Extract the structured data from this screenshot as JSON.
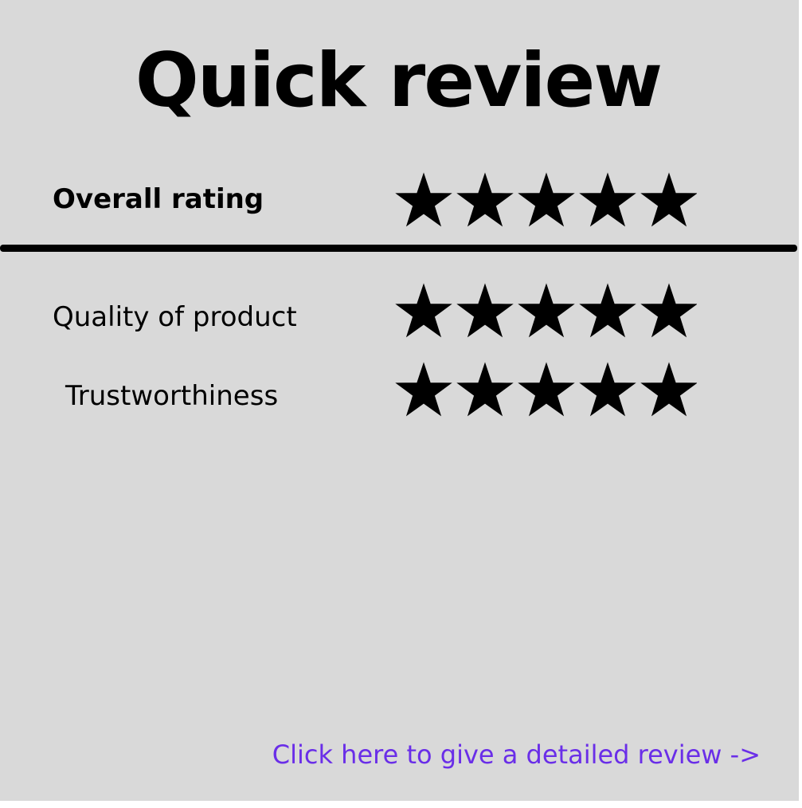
{
  "title": "Quick review",
  "ratings": [
    {
      "id": "overall",
      "label": "Overall rating",
      "stars": 5,
      "max": 5
    },
    {
      "id": "quality",
      "label": "Quality of product",
      "stars": 5,
      "max": 5
    },
    {
      "id": "trust",
      "label": "Trustworthiness",
      "stars": 5,
      "max": 5
    }
  ],
  "link": {
    "label": "Click here to give a detailed review ->"
  },
  "colors": {
    "background": "#d9d9d9",
    "text": "#000000",
    "star": "#000000",
    "link": "#6a2ee8"
  },
  "icons": {
    "rating_star": "star-icon"
  }
}
